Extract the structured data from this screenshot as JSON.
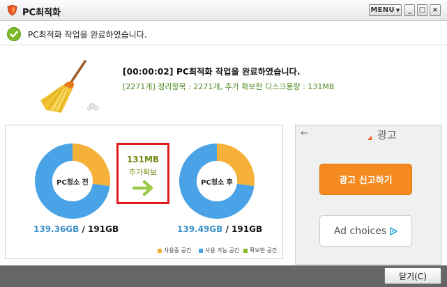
{
  "window": {
    "title": "PC최적화",
    "menu_label": "MENU",
    "minimize_label": "_",
    "maximize_label": "□",
    "close_label": "×"
  },
  "banner": {
    "message": "PC최적화 작업을 완료하였습니다."
  },
  "summary": {
    "headline": "[00:00:02] PC최적화 작업을 완료하였습니다.",
    "detail": "[2271개] 정리항목 : 2271개, 추가 확보한 디스크용량 : 131MB"
  },
  "chart_data": {
    "type": "pie",
    "charts": [
      {
        "label": "PC청소 전",
        "caption_used": "139.36GB",
        "caption_total": "/ 191GB",
        "slices": [
          {
            "name": "사용중 공간",
            "value": 51.84,
            "color": "#f6b13a"
          },
          {
            "name": "사용 가능 공간",
            "value": 139.36,
            "color": "#4aa3e6"
          }
        ]
      },
      {
        "label": "PC청소 후",
        "caption_used": "139.49GB",
        "caption_total": "/ 191GB",
        "slices": [
          {
            "name": "사용중 공간",
            "value": 51.71,
            "color": "#f6b13a"
          },
          {
            "name": "확보한 공간",
            "value": 0.13,
            "color": "#86b82b"
          },
          {
            "name": "사용 가능 공간",
            "value": 139.36,
            "color": "#4aa3e6"
          }
        ]
      }
    ],
    "gain": {
      "amount": "131MB",
      "label": "추가확보"
    },
    "legend": [
      {
        "name": "사용중 공간",
        "color": "#f6b13a"
      },
      {
        "name": "사용 가능 공간",
        "color": "#4aa3e6"
      },
      {
        "name": "확보한 공간",
        "color": "#86b82b"
      }
    ]
  },
  "ad": {
    "back_icon": "←",
    "title": "광고",
    "report_button": "광고 신고하기",
    "choices_button": "Ad choices"
  },
  "footer": {
    "close_button": "닫기(C)"
  }
}
